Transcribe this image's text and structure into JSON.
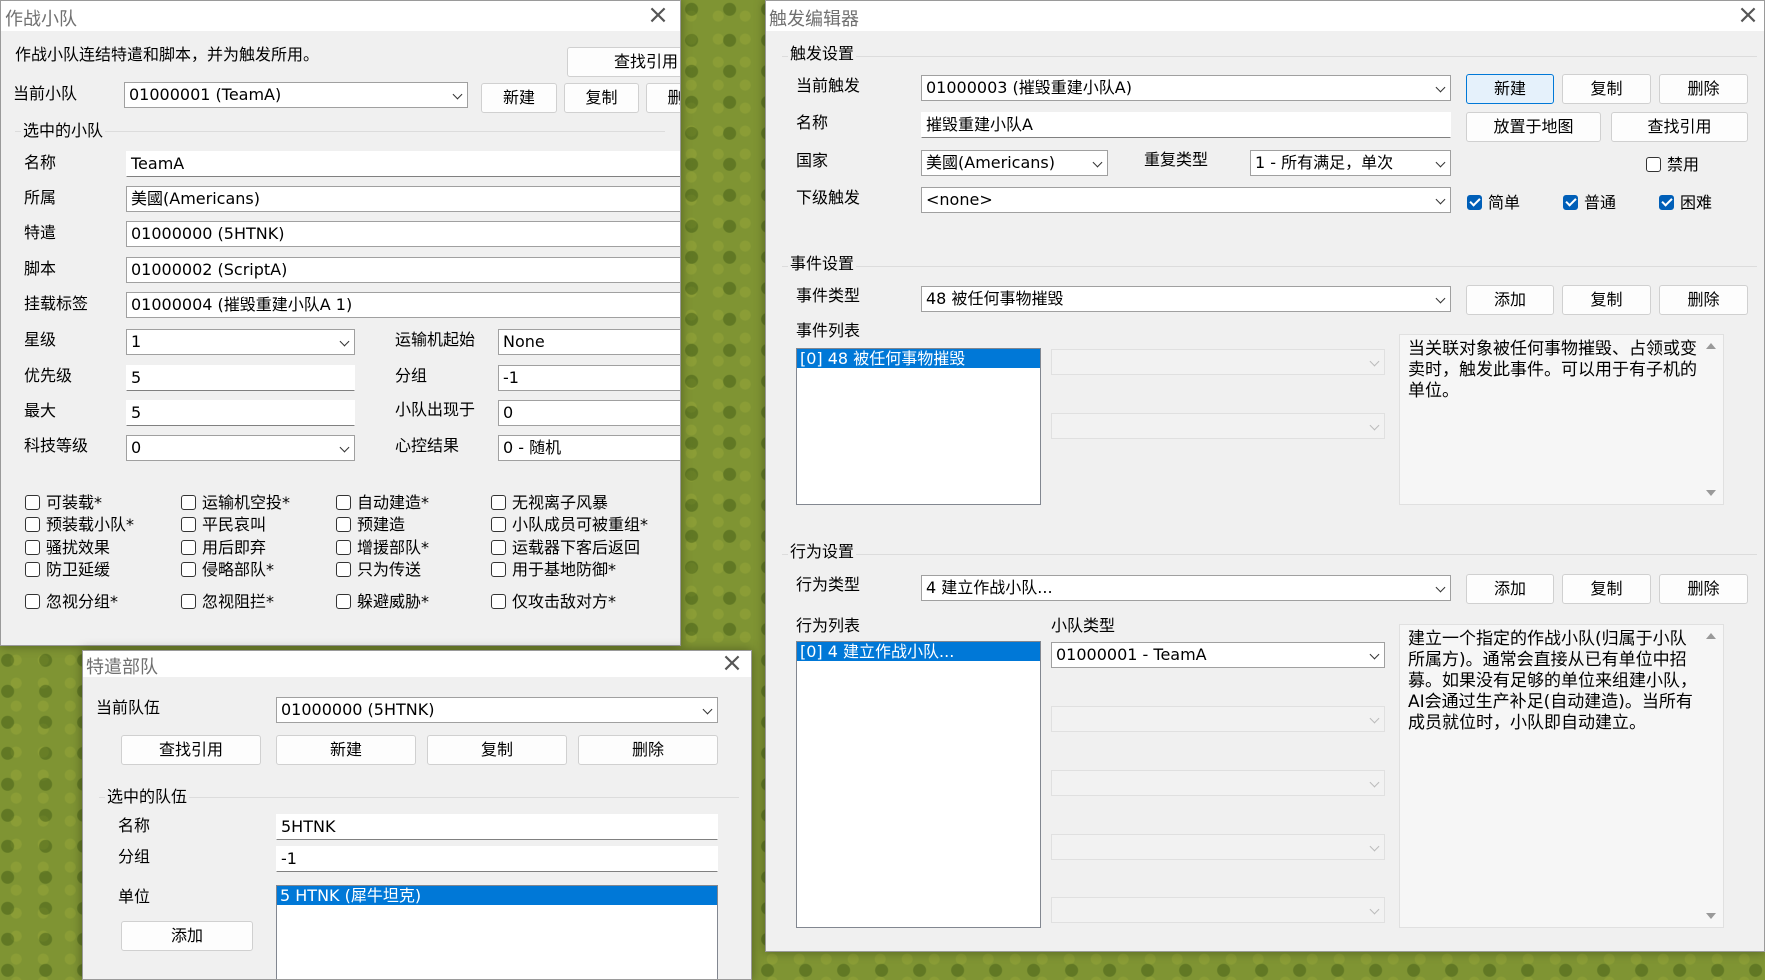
{
  "team_window": {
    "title": "作战小队",
    "intro": "作战小队连结特遣和脚本，并为触发所用。",
    "find_refs": "查找引用",
    "current_label": "当前小队",
    "current_value": "01000001 (TeamA)",
    "new": "新建",
    "copy": "复制",
    "delete": "删除",
    "group_title": "选中的小队",
    "name_label": "名称",
    "name_value": "TeamA",
    "owner_label": "所属",
    "owner_value": "美國(Americans)",
    "taskforce_label": "特遣",
    "taskforce_value": "01000000 (5HTNK)",
    "script_label": "脚本",
    "script_value": "01000002 (ScriptA)",
    "tag_label": "挂载标签",
    "tag_value": "01000004 (摧毁重建小队A 1)",
    "vet_label": "星级",
    "vet_value": "1",
    "priority_label": "优先级",
    "priority_value": "5",
    "max_label": "最大",
    "max_value": "5",
    "techlevel_label": "科技等级",
    "techlevel_value": "0",
    "waypoint_label": "运输机起始",
    "waypoint_value": "None",
    "group_label": "分组",
    "group_value": "-1",
    "house_label": "小队出现于",
    "house_value": "0",
    "mindcontrol_label": "心控结果",
    "mindcontrol_value": "0 - 随机",
    "checkboxes": [
      [
        "可装载*",
        "运输机空投*",
        "自动建造*",
        "无视离子风暴"
      ],
      [
        "预装载小队*",
        "平民哀叫",
        "预建造",
        "小队成员可被重组*"
      ],
      [
        "骚扰效果",
        "用后即弃",
        "增援部队*",
        "运载器下客后返回"
      ],
      [
        "防卫延缓",
        "侵略部队*",
        "只为传送",
        "用于基地防御*"
      ],
      [
        "忽视分组*",
        "忽视阻拦*",
        "躲避威胁*",
        "仅攻击敌对方*"
      ]
    ]
  },
  "taskforce_window": {
    "title": "特遣部队",
    "current_label": "当前队伍",
    "current_value": "01000000 (5HTNK)",
    "find_refs": "查找引用",
    "new": "新建",
    "copy": "复制",
    "delete": "删除",
    "group_title": "选中的队伍",
    "name_label": "名称",
    "name_value": "5HTNK",
    "group_label": "分组",
    "group_value": "-1",
    "units_label": "单位",
    "units": [
      "5 HTNK (犀牛坦克)"
    ],
    "add": "添加"
  },
  "trigger_window": {
    "title": "触发编辑器",
    "settings_title": "触发设置",
    "current_label": "当前触发",
    "current_value": "01000003 (摧毁重建小队A)",
    "new": "新建",
    "copy": "复制",
    "delete": "删除",
    "name_label": "名称",
    "name_value": "摧毁重建小队A",
    "place_on_map": "放置于地图",
    "find_refs": "查找引用",
    "house_label": "国家",
    "house_value": "美國(Americans)",
    "repeat_label": "重复类型",
    "repeat_value": "1 - 所有满足，单次",
    "disabled_label": "禁用",
    "sub_label": "下级触发",
    "sub_value": "<none>",
    "easy_label": "简单",
    "normal_label": "普通",
    "hard_label": "困难",
    "event_title": "事件设置",
    "event_type_label": "事件类型",
    "event_type_value": "48 被任何事物摧毁",
    "event_add": "添加",
    "event_list_label": "事件列表",
    "events": [
      "[0] 48 被任何事物摧毁"
    ],
    "event_desc": "当关联对象被任何事物摧毁、占领或变卖时，触发此事件。可以用于有子机的单位。",
    "action_title": "行为设置",
    "action_type_label": "行为类型",
    "action_type_value": "4 建立作战小队...",
    "action_add": "添加",
    "action_list_label": "行为列表",
    "actions": [
      "[0] 4 建立作战小队..."
    ],
    "team_type_label": "小队类型",
    "team_type_value": "01000001 - TeamA",
    "action_desc": "建立一个指定的作战小队(归属于小队所属方)。通常会直接从已有单位中招募。如果没有足够的单位来组建小队，AI会通过生产补足(自动建造)。当所有成员就位时，小队即自动建立。"
  }
}
